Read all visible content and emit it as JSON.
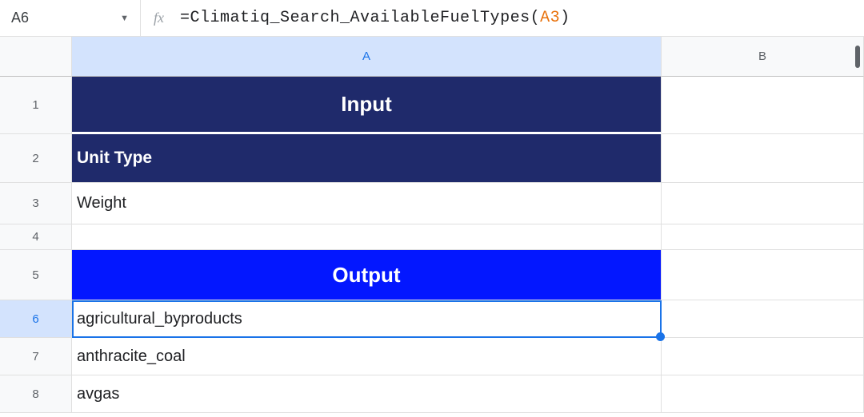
{
  "formula_bar": {
    "cell_ref": "A6",
    "fx_label": "fx",
    "formula_prefix": "=Climatiq_Search_AvailableFuelTypes(",
    "formula_arg": "A3",
    "formula_suffix": ")"
  },
  "columns": [
    "A",
    "B"
  ],
  "rows": [
    "1",
    "2",
    "3",
    "4",
    "5",
    "6",
    "7",
    "8"
  ],
  "selected_cell": "A6",
  "cells": {
    "a1": "Input",
    "a2": "Unit Type",
    "a3": "Weight",
    "a4": "",
    "a5": "Output",
    "a6": "agricultural_byproducts",
    "a7": "anthracite_coal",
    "a8": "avgas"
  }
}
